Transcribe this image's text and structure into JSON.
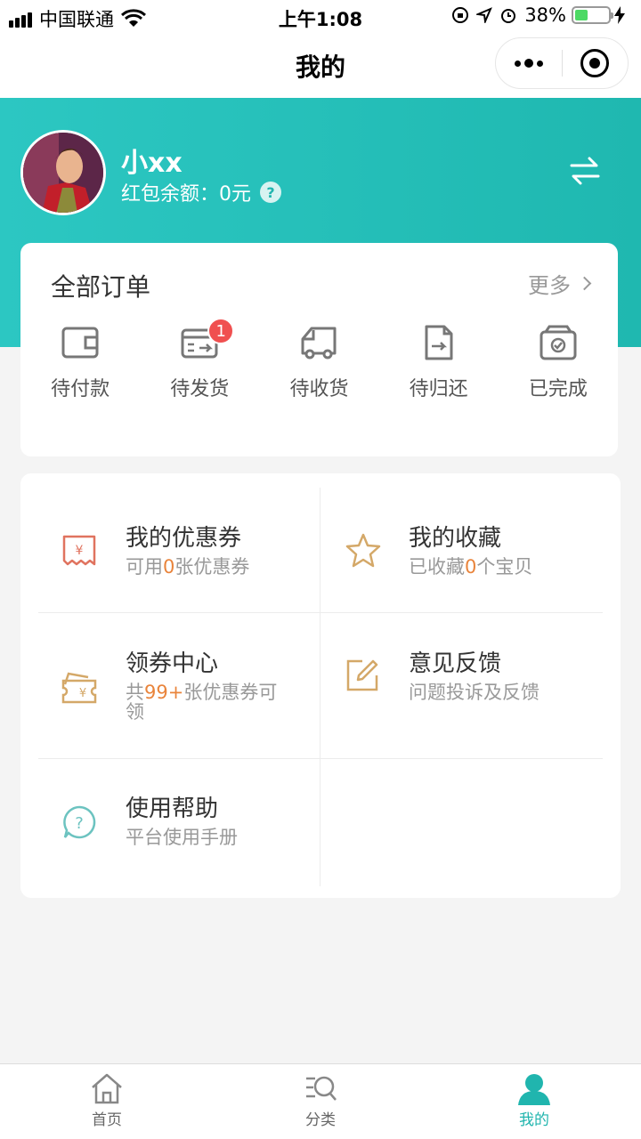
{
  "status_bar": {
    "carrier": "中国联通",
    "time": "上午1:08",
    "battery": "38%",
    "battery_level": 0.38
  },
  "nav": {
    "title": "我的"
  },
  "profile": {
    "name": "小xx",
    "balance": "红包余额：0元",
    "help_glyph": "?"
  },
  "orders": {
    "title": "全部订单",
    "more": "更多",
    "items": [
      {
        "label": "待付款",
        "icon": "wallet-icon"
      },
      {
        "label": "待发货",
        "icon": "card-transfer-icon",
        "badge": "1"
      },
      {
        "label": "待收货",
        "icon": "truck-icon"
      },
      {
        "label": "待归还",
        "icon": "document-return-icon"
      },
      {
        "label": "已完成",
        "icon": "box-check-icon"
      }
    ]
  },
  "services": {
    "coupon": {
      "title": "我的优惠券",
      "sub_pre": "可用",
      "sub_num": "0",
      "sub_post": "张优惠券",
      "icon": "coupon-icon"
    },
    "favorites": {
      "title": "我的收藏",
      "sub_pre": "已收藏",
      "sub_num": "0",
      "sub_post": "个宝贝",
      "icon": "star-icon"
    },
    "coupon_center": {
      "title": "领券中心",
      "sub_pre": "共",
      "sub_num": "99+",
      "sub_post": "张优惠券可领",
      "icon": "ticket-icon"
    },
    "feedback": {
      "title": "意见反馈",
      "sub": "问题投诉及反馈",
      "icon": "edit-icon"
    },
    "help": {
      "title": "使用帮助",
      "sub": "平台使用手册",
      "icon": "help-icon"
    }
  },
  "tabbar": {
    "items": [
      {
        "label": "首页",
        "icon": "home-icon"
      },
      {
        "label": "分类",
        "icon": "category-search-icon"
      },
      {
        "label": "我的",
        "icon": "user-icon",
        "active": true
      }
    ]
  },
  "colors": {
    "brand": "#20b5ae",
    "accent": "#e9843b",
    "badge": "#f05050"
  }
}
